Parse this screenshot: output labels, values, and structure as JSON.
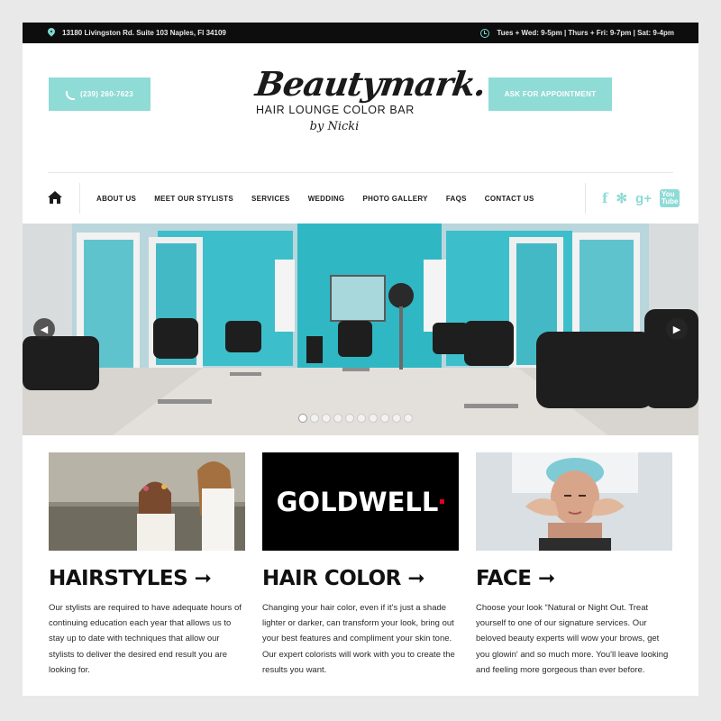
{
  "topbar": {
    "address": "13180 Livingston Rd. Suite 103 Naples, Fl 34109",
    "hours": "Tues + Wed: 9-5pm | Thurs + Fri: 9-7pm | Sat: 9-4pm"
  },
  "header": {
    "phone_label": "(239) 260-7623",
    "appointment_label": "ASK FOR APPOINTMENT",
    "logo": {
      "name": "Beautymark.",
      "tagline": "HAIR LOUNGE  COLOR BAR",
      "byline": "by Nicki"
    }
  },
  "nav": {
    "items": [
      {
        "label": "ABOUT US"
      },
      {
        "label": "MEET OUR STYLISTS"
      },
      {
        "label": "SERVICES"
      },
      {
        "label": "WEDDING"
      },
      {
        "label": "PHOTO GALLERY"
      },
      {
        "label": "FAQS"
      },
      {
        "label": "CONTACT US"
      }
    ],
    "social": [
      {
        "icon": "facebook-icon",
        "glyph": "f"
      },
      {
        "icon": "yelp-icon",
        "glyph": "✻"
      },
      {
        "icon": "google-plus-icon",
        "glyph": "g+"
      },
      {
        "icon": "youtube-icon",
        "glyph": "You Tube"
      }
    ]
  },
  "slider": {
    "prev_glyph": "◀",
    "next_glyph": "▶",
    "slide_count": 10,
    "active_slide": 1
  },
  "cards": [
    {
      "title": "HAIRSTYLES ➞",
      "text": "Our stylists are required to have adequate hours of continuing education each year that allows us to stay up to date with techniques that allow our stylists to deliver the desired end result you are looking for."
    },
    {
      "title": "HAIR COLOR ➞",
      "image_text": "GOLDWELL",
      "text": "Changing your hair color, even if it's just a shade lighter or darker, can transform your look, bring out your best features and compliment your skin tone. Our expert colorists will work with you to create the results you want."
    },
    {
      "title": "FACE ➞",
      "text": "Choose your look “Natural or Night Out. Treat yourself to one of our signature services. Our beloved beauty experts will wow your brows, get you glowin' and so much more. You'll leave looking and feeling more gorgeous than ever before."
    }
  ],
  "colors": {
    "accent": "#8fdbd6",
    "topbar_bg": "#0d0d0d",
    "page_bg": "#e9e9ea",
    "salon_wall": "#2fb7c4"
  }
}
